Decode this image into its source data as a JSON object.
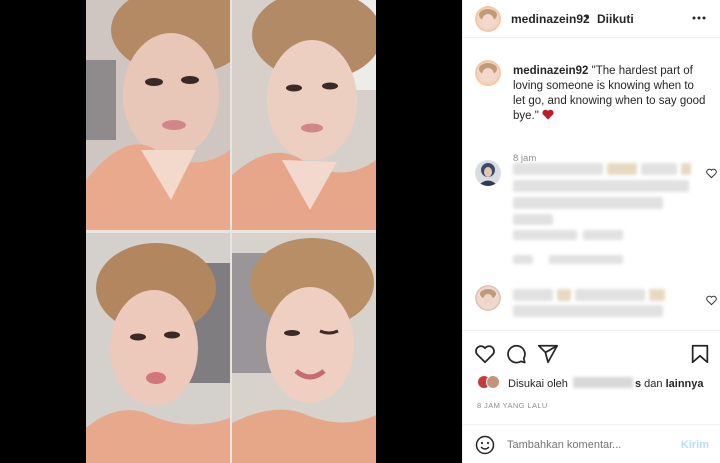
{
  "post": {
    "username": "medinazein92",
    "separator": "•",
    "follow_status": "Diikuti",
    "more_icon": "more-horizontal-icon"
  },
  "caption": {
    "username": "medinazein92",
    "text": "\"The hardest part of loving someone is knowing when to let go, and knowing when to say good bye.\"",
    "emoji": "heart",
    "time": "8 jam"
  },
  "actions": {
    "icons": [
      "heart-icon",
      "comment-icon",
      "share-icon",
      "bookmark-icon"
    ]
  },
  "likes": {
    "prefix": "Disukai oleh",
    "redacted_suffix": "s",
    "conj": "dan",
    "others": "lainnya"
  },
  "timestamp": "8 JAM YANG LALU",
  "comment_box": {
    "placeholder": "Tambahkan komentar...",
    "post_label": "Kirim"
  },
  "colors": {
    "accent": "#0095f6",
    "post_disabled": "#b2dffc",
    "muted": "#8e8e8e",
    "text": "#262626",
    "heart_emoji": "#c0192c"
  }
}
